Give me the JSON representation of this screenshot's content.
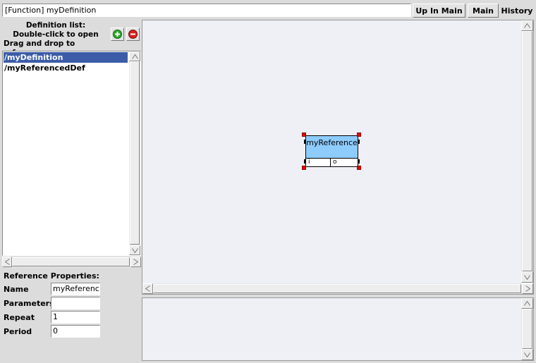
{
  "topbar": {
    "title_field": "[Function] myDefinition",
    "up_in_main": "Up In Main",
    "main": "Main",
    "history": "History"
  },
  "definitions": {
    "header_line1": "Definition list:",
    "header_line2": "Double-click to open",
    "header_line3": "Drag and drop to reference",
    "items": [
      "/myDefinition",
      "/myReferencedDef"
    ],
    "selected_index": 0
  },
  "reference_properties": {
    "heading": "Reference Properties:",
    "name_label": "Name",
    "name_value": "myReferenc",
    "parameters_label": "Parameters",
    "parameters_value": "",
    "repeat_label": "Repeat",
    "repeat_value": "1",
    "period_label": "Period",
    "period_value": "0"
  },
  "canvas": {
    "block": {
      "name": "myReference",
      "input_port": "i",
      "output_port": "o",
      "fill_color": "#8ecbff"
    }
  },
  "colors": {
    "selection": "#3c5ca8",
    "canvas_bg": "#eef0f6",
    "add_icon": "#2aa82a",
    "remove_icon": "#d82020",
    "handle": "#e00000"
  }
}
